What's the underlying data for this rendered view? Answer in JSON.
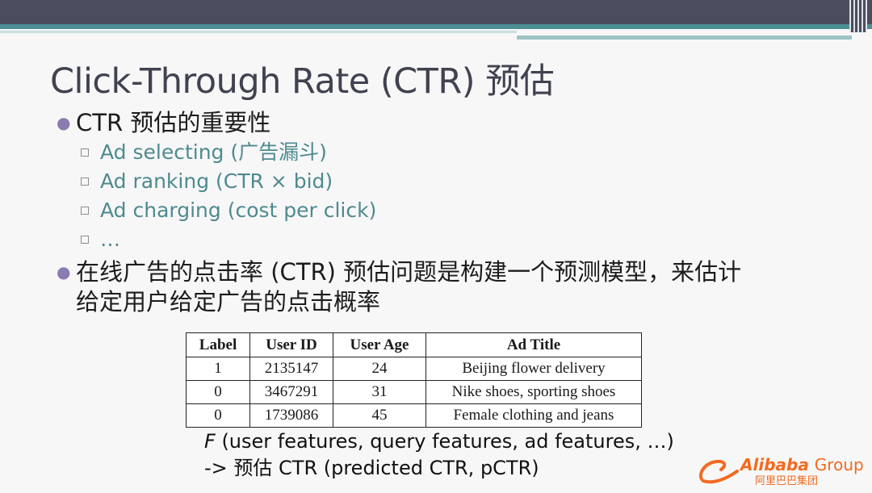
{
  "slide": {
    "title": "Click-Through Rate (CTR) 预估",
    "bullet1": {
      "text": "CTR 预估的重要性",
      "sub_items": [
        "Ad selecting (广告漏斗)",
        "Ad ranking (CTR × bid)",
        "Ad charging (cost per click)",
        "…"
      ]
    },
    "bullet2": {
      "line1": "在线广告的点击率 (CTR) 预估问题是构建一个预测模型，来估计",
      "line2": "给定用户给定广告的点击概率"
    },
    "table": {
      "headers": [
        "Label",
        "User ID",
        "User Age",
        "Ad Title"
      ],
      "rows": [
        [
          "1",
          "2135147",
          "24",
          "Beijing flower delivery"
        ],
        [
          "0",
          "3467291",
          "31",
          "Nike shoes, sporting shoes"
        ],
        [
          "0",
          "1739086",
          "45",
          "Female clothing and jeans"
        ]
      ]
    },
    "formula": {
      "var": "F",
      "args": " (user features, query features, ad features, …)",
      "line2": "-> 预估 CTR (predicted CTR, pCTR)"
    },
    "logo": {
      "brand": "Alibaba",
      "group": "Group",
      "chinese": "阿里巴巴集团"
    }
  },
  "colors": {
    "banner": "#4a4d5e",
    "teal": "#4b8f95",
    "sub_item_text": "#4e8a90",
    "bullet_dot": "#8a7cb0",
    "logo_orange": "#f26b21"
  }
}
